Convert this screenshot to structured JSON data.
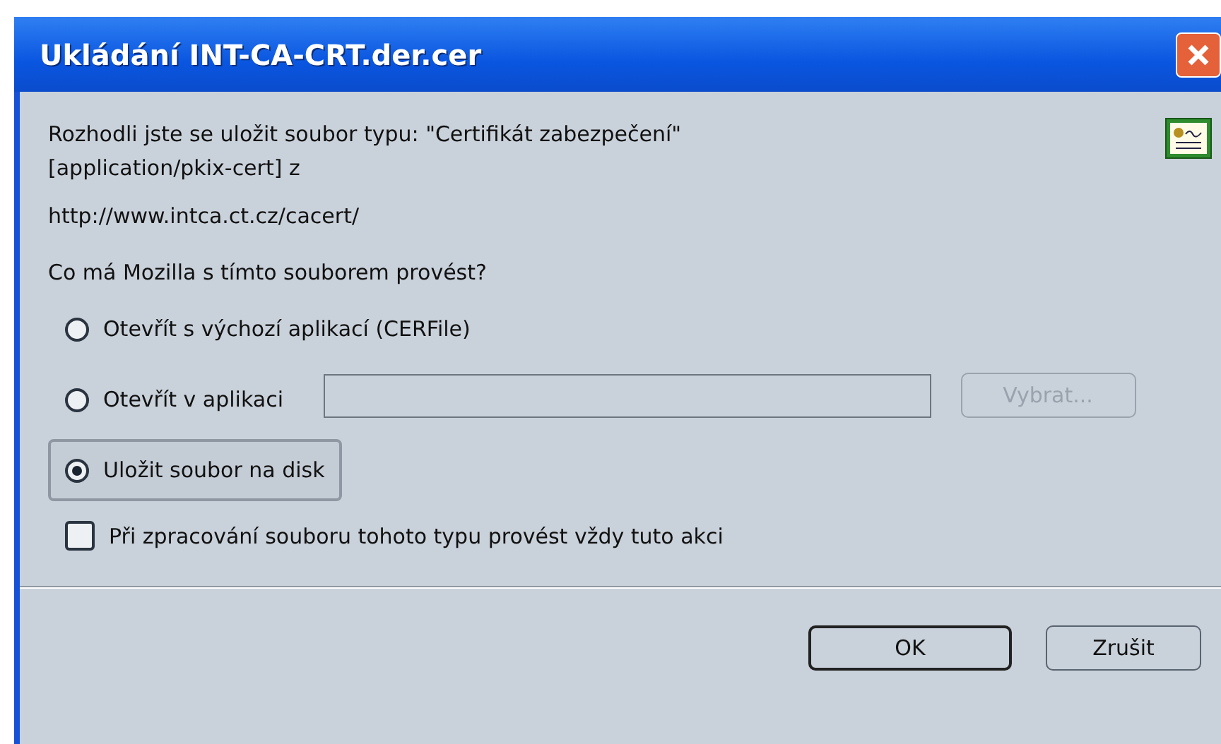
{
  "window": {
    "title": "Ukládání INT-CA-CRT.der.cer"
  },
  "message": [
    "Rozhodli jste se uložit soubor typu: \"Certifikát zabezpečení\"",
    "[application/pkix-cert] z"
  ],
  "source_url": "http://www.intca.ct.cz/cacert/",
  "question": "Co má Mozilla s tímto souborem provést?",
  "options": [
    {
      "kind": "plain",
      "label": "Otevřít s výchozí aplikací (CERFile)",
      "selected": false
    },
    {
      "kind": "app",
      "label": "Otevřít v aplikaci",
      "selected": false,
      "button": {
        "label": "Vybrat...",
        "disabled": true
      }
    },
    {
      "kind": "plain",
      "label": "Uložit soubor na disk",
      "selected": true
    }
  ],
  "remember": {
    "label": "Při zpracování souboru tohoto typu provést vždy tuto akci",
    "checked": false
  },
  "buttons": [
    {
      "label": "OK",
      "default": true
    },
    {
      "label": "Zrušit",
      "default": false
    }
  ]
}
